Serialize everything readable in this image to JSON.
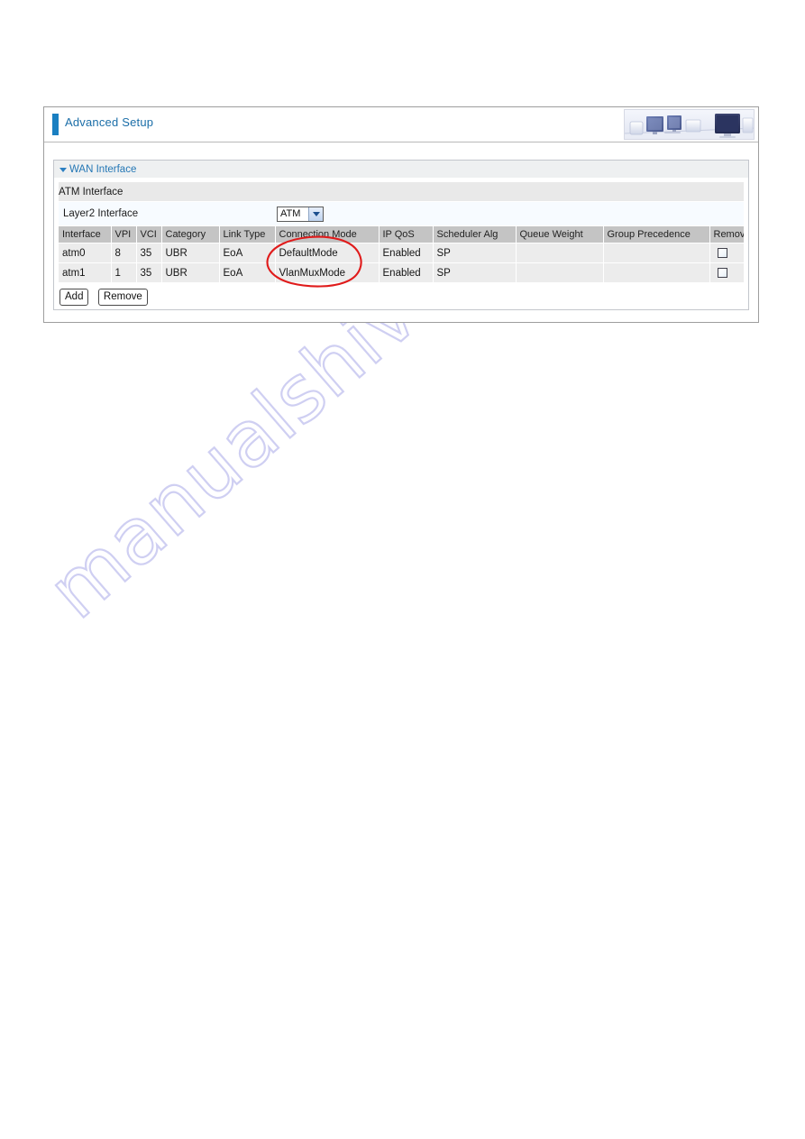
{
  "header": {
    "title": "Advanced Setup",
    "art_alt": "office-computers-banner",
    "accent_color": "#1a7fc1",
    "title_color": "#1b6ea8"
  },
  "module": {
    "title": "WAN Interface",
    "collapse_icon": "triangle-down-icon",
    "section_label": "ATM Interface",
    "layer2": {
      "label": "Layer2 Interface",
      "select_value": "ATM",
      "select_options": [
        "ATM"
      ],
      "arrow_icon": "chevron-down-icon"
    },
    "table": {
      "columns": [
        "Interface",
        "VPI",
        "VCI",
        "Category",
        "Link Type",
        "Connection Mode",
        "IP QoS",
        "Scheduler Alg",
        "Queue Weight",
        "Group Precedence",
        "Remove"
      ],
      "rows": [
        {
          "interface": "atm0",
          "vpi": "8",
          "vci": "35",
          "category": "UBR",
          "link_type": "EoA",
          "connection_mode": "DefaultMode",
          "ip_qos": "Enabled",
          "scheduler_alg": "SP",
          "queue_weight": "",
          "group_precedence": "",
          "remove_checked": false
        },
        {
          "interface": "atm1",
          "vpi": "1",
          "vci": "35",
          "category": "UBR",
          "link_type": "EoA",
          "connection_mode": "VlanMuxMode",
          "ip_qos": "Enabled",
          "scheduler_alg": "SP",
          "queue_weight": "",
          "group_precedence": "",
          "remove_checked": false
        }
      ]
    },
    "buttons": {
      "add": "Add",
      "remove": "Remove"
    }
  },
  "annotation": {
    "shape": "hand-drawn-ellipse",
    "color": "#e01b1b",
    "highlights": "Connection Mode column values"
  },
  "watermark": {
    "text": "manualshive.com",
    "color": "#cfcff2"
  }
}
